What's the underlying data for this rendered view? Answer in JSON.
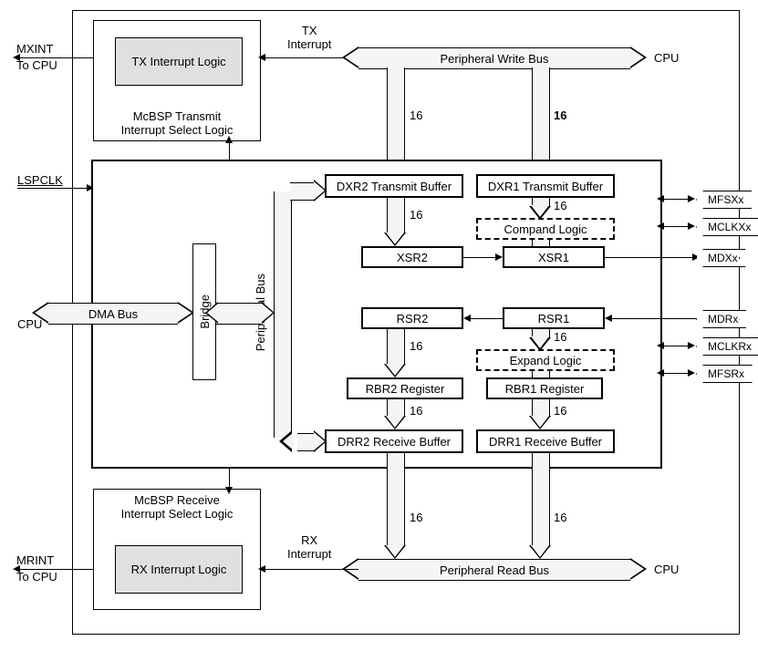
{
  "signals": {
    "mxint": "MXINT",
    "mxint_sub": "To CPU",
    "lspclk": "LSPCLK",
    "cpu_left": "CPU",
    "mrint": "MRINT",
    "mrint_sub": "To CPU",
    "cpu_top_right": "CPU",
    "cpu_bottom_right": "CPU"
  },
  "pins": {
    "mfsxx": "MFSXx",
    "mclkxx": "MCLKXx",
    "mdxx": "MDXx",
    "mdrx": "MDRx",
    "mclkrx": "MCLKRx",
    "mfsrx": "MFSRx"
  },
  "blocks": {
    "tx_logic": "TX Interrupt Logic",
    "tx_select": "McBSP Transmit\nInterrupt Select Logic",
    "rx_logic": "RX Interrupt Logic",
    "rx_select": "McBSP Receive\nInterrupt Select Logic",
    "bridge": "Bridge",
    "dma_bus": "DMA Bus",
    "peripheral_bus": "Peripheral Bus",
    "pwrite_bus": "Peripheral Write Bus",
    "pread_bus": "Peripheral Read Bus",
    "dxr2": "DXR2 Transmit Buffer",
    "dxr1": "DXR1 Transmit Buffer",
    "compand": "Compand Logic",
    "xsr2": "XSR2",
    "xsr1": "XSR1",
    "rsr2": "RSR2",
    "rsr1": "RSR1",
    "expand": "Expand Logic",
    "rbr2": "RBR2 Register",
    "rbr1": "RBR1 Register",
    "drr2": "DRR2 Receive Buffer",
    "drr1": "DRR1 Receive Buffer"
  },
  "labels": {
    "tx_interrupt": "TX\nInterrupt",
    "rx_interrupt": "RX\nInterrupt",
    "w16": "16",
    "w16_bold": "16"
  }
}
